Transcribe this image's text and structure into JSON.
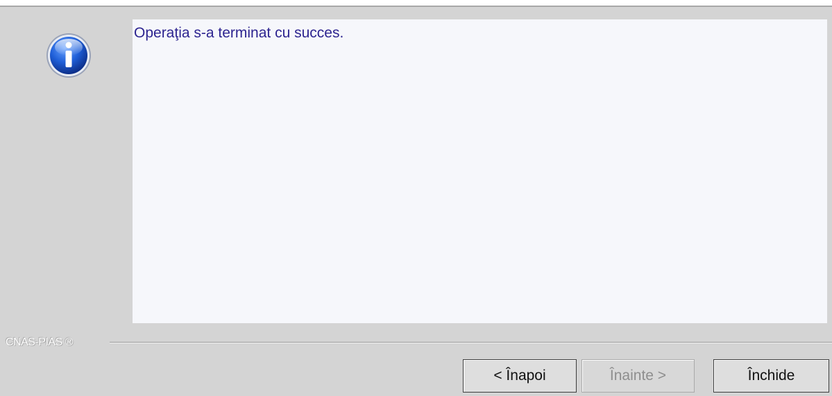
{
  "dialog": {
    "message": "Operaţia s-a terminat cu succes.",
    "brand": "CNAS-PIAS ®",
    "icon": "info-icon"
  },
  "buttons": {
    "back_label": "< Înapoi",
    "next_label": "Înainte >",
    "close_label": "Închide"
  },
  "colors": {
    "window_bg": "#d4d4d4",
    "panel_bg": "#f6f7fb",
    "message_text": "#2d2490",
    "icon_blue": "#1f5fd8"
  }
}
